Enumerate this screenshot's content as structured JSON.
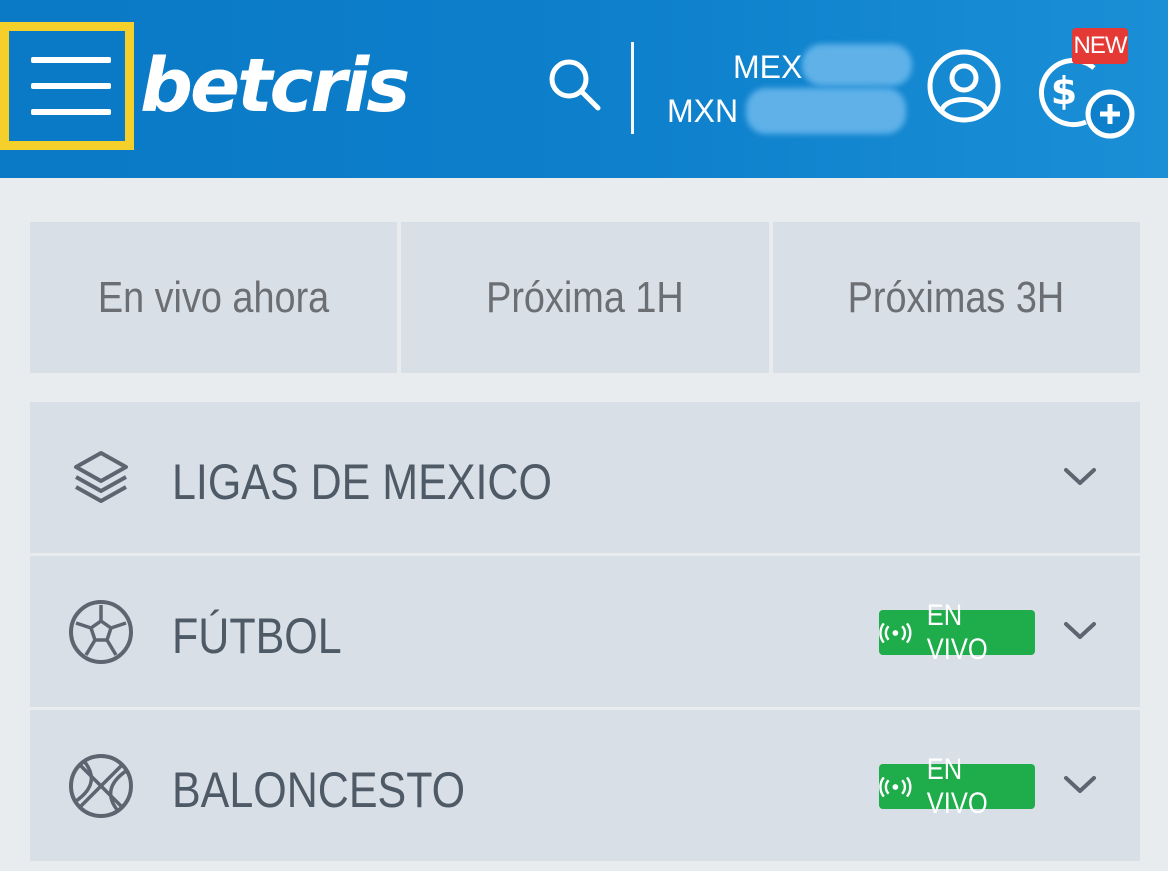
{
  "header": {
    "logo": "betcris",
    "balance": {
      "currency_top": "MEX",
      "currency_bottom": "MXN"
    },
    "new_badge": "NEW"
  },
  "tabs": [
    {
      "label": "En vivo ahora"
    },
    {
      "label": "Próxima 1H"
    },
    {
      "label": "Próximas 3H"
    }
  ],
  "sports": [
    {
      "label": "LIGAS DE MEXICO",
      "icon": "layers-icon"
    },
    {
      "label": "FÚTBOL",
      "icon": "soccer-ball-icon",
      "live_label": "EN VIVO"
    },
    {
      "label": "BALONCESTO",
      "icon": "basketball-icon",
      "live_label": "EN VIVO"
    }
  ],
  "colors": {
    "header_bg": "#0d7fcb",
    "highlight": "#f5d02a",
    "live_green": "#1fac4b",
    "new_red": "#e53935",
    "row_bg": "#d9dfe7",
    "page_bg": "#e9ecef"
  }
}
